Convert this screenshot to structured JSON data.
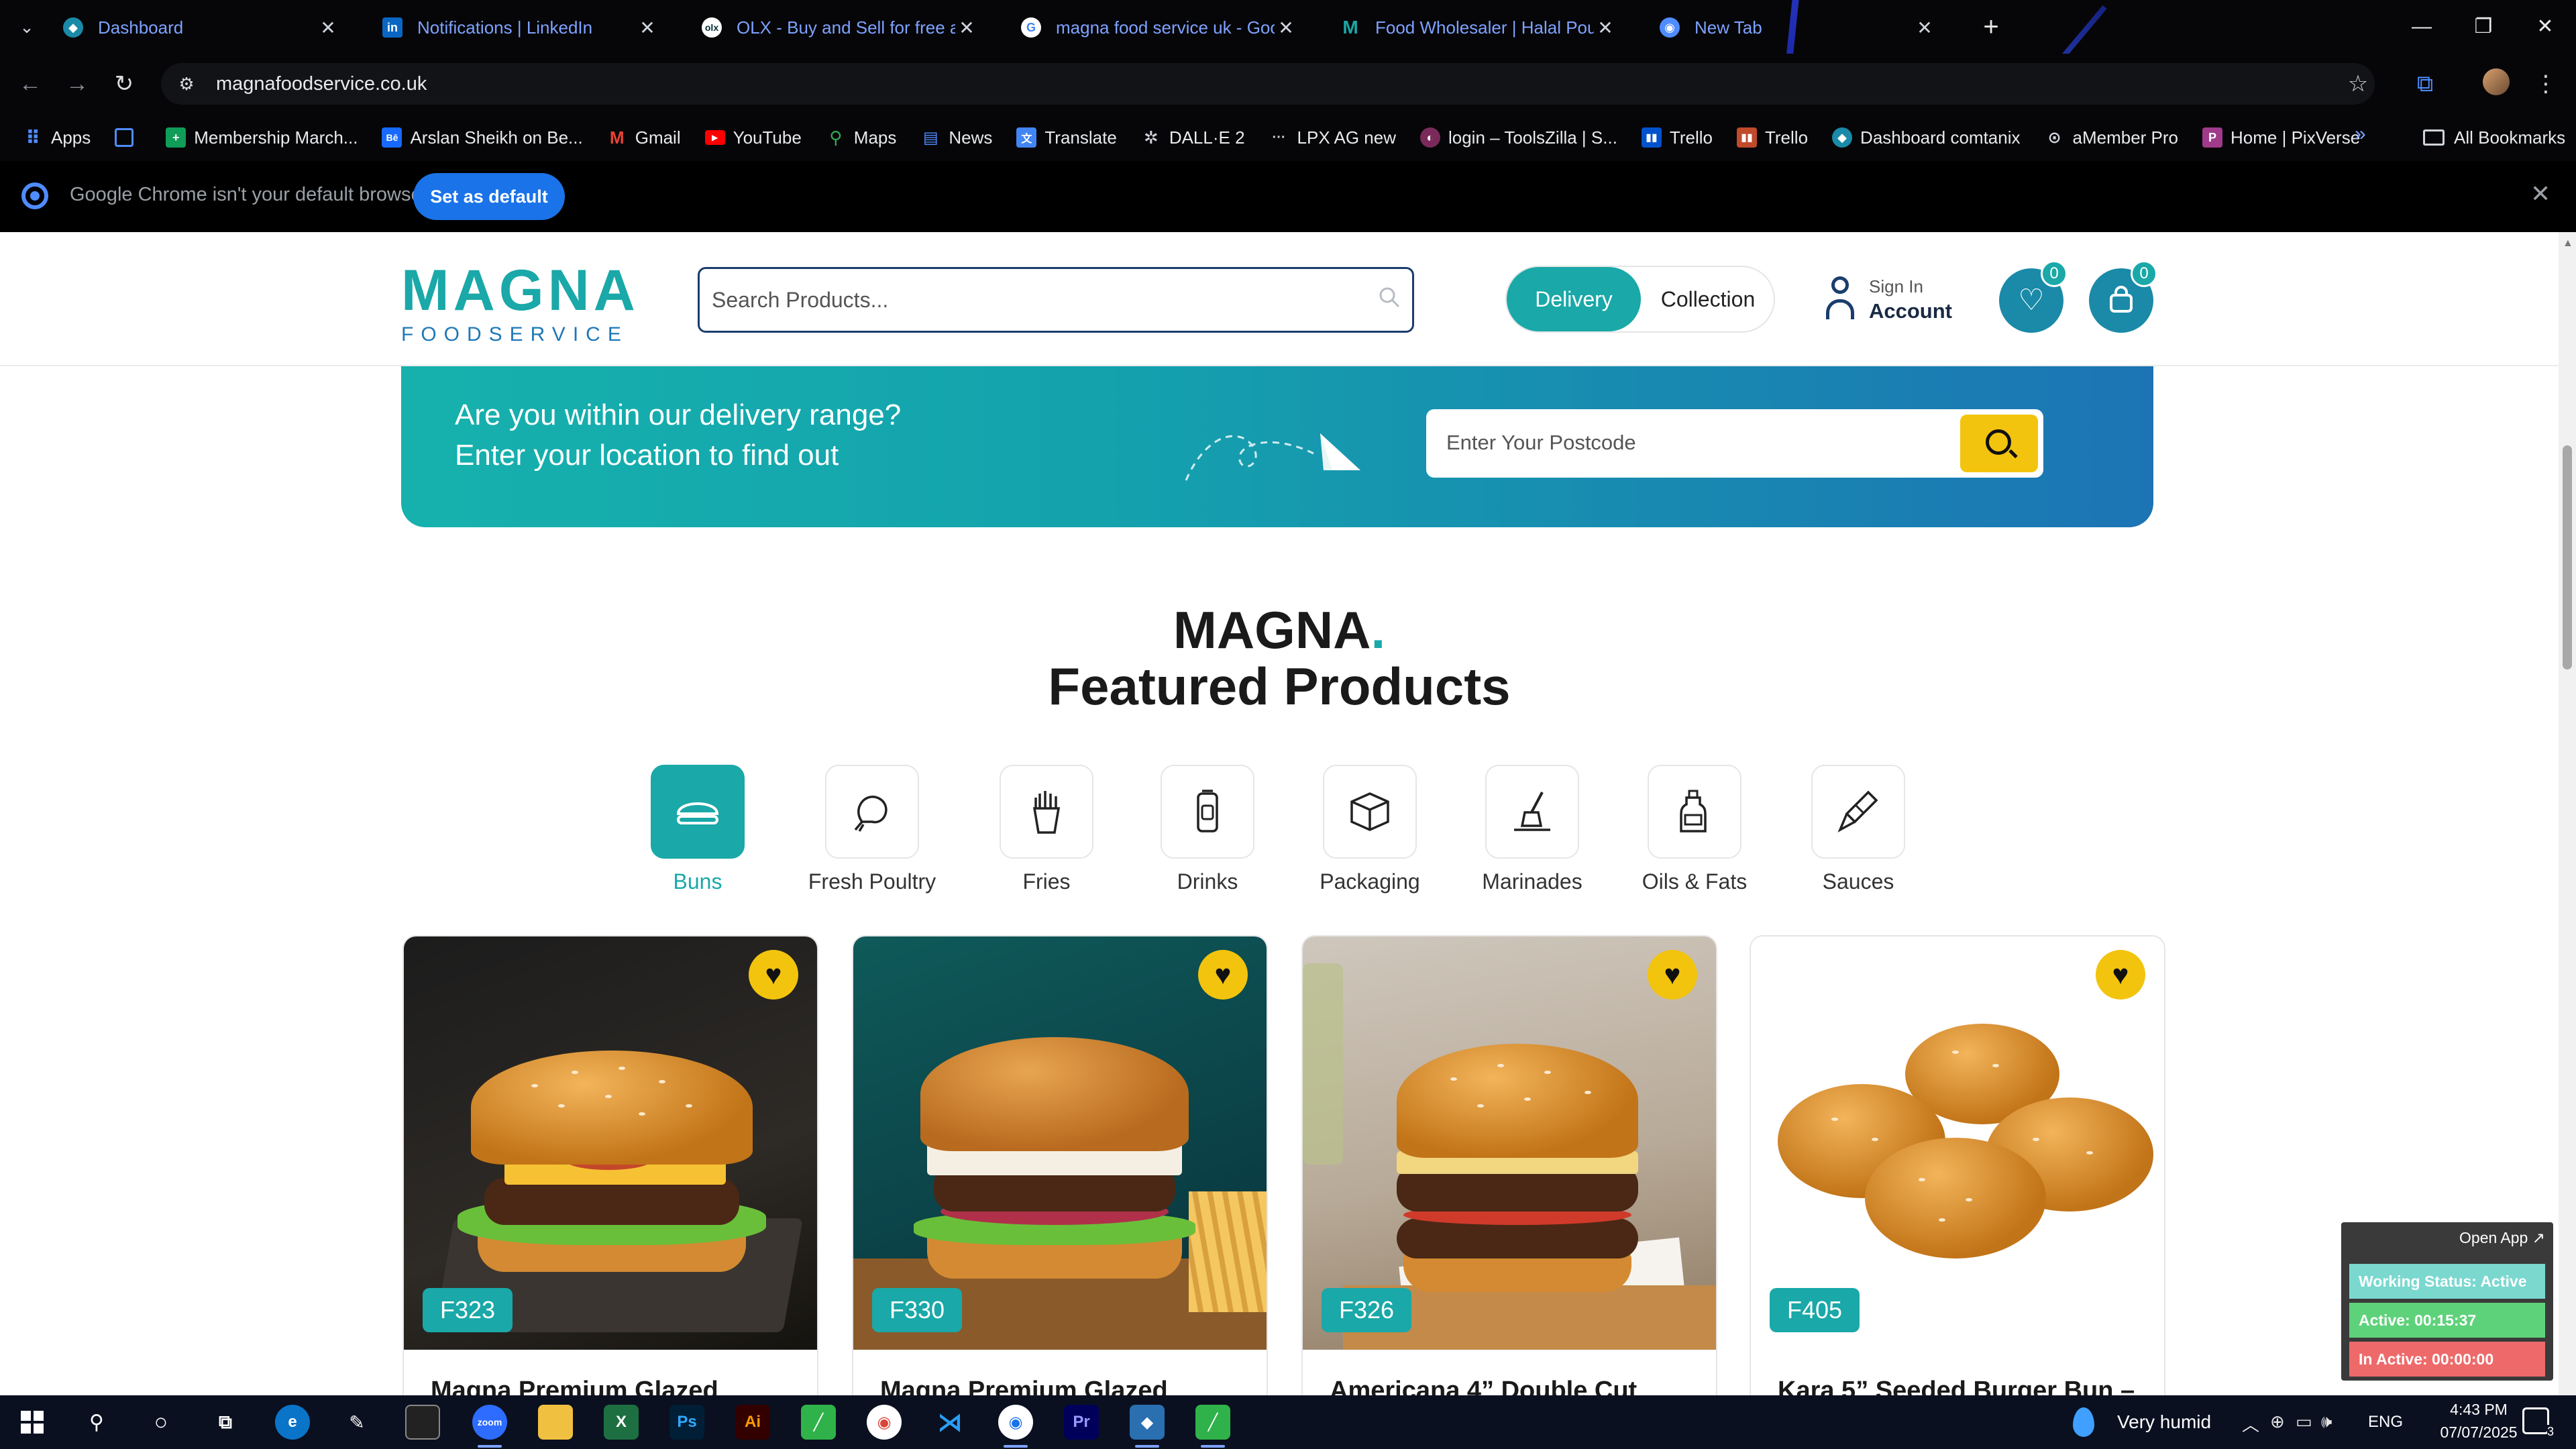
{
  "browser": {
    "tabs": [
      {
        "title": "Dashboard",
        "icon": "dashboard-favicon-icon",
        "color": "#1a8aa8"
      },
      {
        "title": "Notifications | LinkedIn",
        "icon": "linkedin-icon",
        "color": "#0a66c2"
      },
      {
        "title": "OLX - Buy and Sell for free anyw",
        "icon": "olx-icon",
        "color": "#23e5db"
      },
      {
        "title": "magna food service uk - Google",
        "icon": "google-icon",
        "color": "#ffffff"
      },
      {
        "title": "Food Wholesaler | Halal Poultry",
        "icon": "magna-favicon-icon",
        "color": "#1aa8a8"
      },
      {
        "title": "New Tab",
        "icon": "chrome-icon",
        "color": "#4f8cff"
      }
    ],
    "address": "magnafoodservice.co.uk",
    "bookmarks": [
      {
        "label": "Apps",
        "icon": "apps-grid-icon",
        "color": "#4f8cff"
      },
      {
        "label": "",
        "icon": "grid-icon",
        "color": "#4f8cff"
      },
      {
        "label": "Membership March...",
        "icon": "sheets-icon",
        "color": "#0f9d58"
      },
      {
        "label": "Arslan Sheikh on Be...",
        "icon": "behance-icon",
        "color": "#1769ff"
      },
      {
        "label": "Gmail",
        "icon": "gmail-icon",
        "color": "#ea4335"
      },
      {
        "label": "YouTube",
        "icon": "youtube-icon",
        "color": "#ff0000"
      },
      {
        "label": "Maps",
        "icon": "maps-icon",
        "color": "#34a853"
      },
      {
        "label": "News",
        "icon": "news-icon",
        "color": "#4f8cff"
      },
      {
        "label": "Translate",
        "icon": "translate-icon",
        "color": "#4285f4"
      },
      {
        "label": "DALL·E 2",
        "icon": "openai-icon",
        "color": "#444444"
      },
      {
        "label": "LPX AG new",
        "icon": "dots-icon",
        "color": "#444444"
      },
      {
        "label": "login – ToolsZilla | S...",
        "icon": "toolszilla-icon",
        "color": "#7a2a5a"
      },
      {
        "label": "Trello",
        "icon": "trello-icon",
        "color": "#0052cc"
      },
      {
        "label": "Trello",
        "icon": "trello-icon",
        "color": "#c04a2a"
      },
      {
        "label": "Dashboard comtanix",
        "icon": "comtanix-icon",
        "color": "#1a8aa8"
      },
      {
        "label": "aMember Pro",
        "icon": "amember-icon",
        "color": "#888888"
      },
      {
        "label": "Home | PixVerse",
        "icon": "pixverse-icon",
        "color": "#a03a8a"
      }
    ],
    "all_bookmarks": "All Bookmarks",
    "infobar": {
      "message": "Google Chrome isn't your default browser",
      "button": "Set as default"
    }
  },
  "site": {
    "logo": {
      "big": "MAGNA",
      "small": "FOODSERVICE"
    },
    "search_placeholder": "Search Products...",
    "delivery_label": "Delivery",
    "collection_label": "Collection",
    "sign_in": "Sign In",
    "account": "Account",
    "wishlist_count": "0",
    "cart_count": "0",
    "banner": {
      "line1": "Are you within our delivery range?",
      "line2": "Enter your location to find out",
      "postcode_placeholder": "Enter Your Postcode"
    },
    "featured_brand": "MAGNA",
    "featured_dot": ".",
    "featured_title": "Featured Products",
    "categories": [
      {
        "label": "Buns",
        "icon": "bun-icon",
        "active": true
      },
      {
        "label": "Fresh Poultry",
        "icon": "chicken-icon",
        "active": false
      },
      {
        "label": "Fries",
        "icon": "fries-icon",
        "active": false
      },
      {
        "label": "Drinks",
        "icon": "drink-can-icon",
        "active": false
      },
      {
        "label": "Packaging",
        "icon": "box-icon",
        "active": false
      },
      {
        "label": "Marinades",
        "icon": "brush-icon",
        "active": false
      },
      {
        "label": "Oils & Fats",
        "icon": "oil-bottle-icon",
        "active": false
      },
      {
        "label": "Sauces",
        "icon": "sauce-bottle-icon",
        "active": false
      }
    ],
    "products": [
      {
        "code": "F323",
        "name": "Magna Premium Glazed"
      },
      {
        "code": "F330",
        "name": "Magna Premium Glazed"
      },
      {
        "code": "F326",
        "name": "Americana 4” Double Cut"
      },
      {
        "code": "F405",
        "name": "Kara 5” Seeded Burger Bun –"
      }
    ]
  },
  "tracker": {
    "open_app": "Open App ↗",
    "status": "Working Status: Active",
    "active": "Active: 00:15:37",
    "inactive": "In Active: 00:00:00"
  },
  "taskbar": {
    "weather": "Very humid",
    "lang": "ENG",
    "time": "4:43 PM",
    "date": "07/07/2025",
    "notifications": "3"
  },
  "colors": {
    "brand_teal": "#1aa8a8",
    "brand_blue": "#1c74b4",
    "accent_yellow": "#f3c40e"
  }
}
